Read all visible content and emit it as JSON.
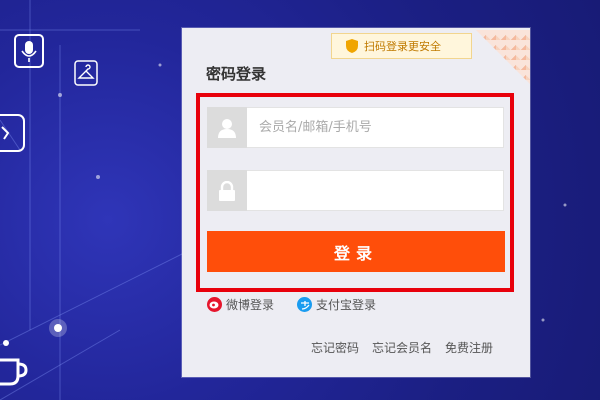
{
  "login": {
    "title": "密码登录",
    "qr_tip": "扫码登录更安全",
    "username_placeholder": "会员名/邮箱/手机号",
    "password_value": "",
    "submit_label": "登录"
  },
  "alt_logins": [
    {
      "label": "微博登录",
      "color": "#e6162d"
    },
    {
      "label": "支付宝登录",
      "color": "#1a9cf0"
    }
  ],
  "links": {
    "forgot_password": "忘记密码",
    "forgot_member": "忘记会员名",
    "register": "免费注册"
  },
  "colors": {
    "accent": "#ff4e0a",
    "highlight_frame": "#e8000b",
    "background": "#1f2390"
  }
}
